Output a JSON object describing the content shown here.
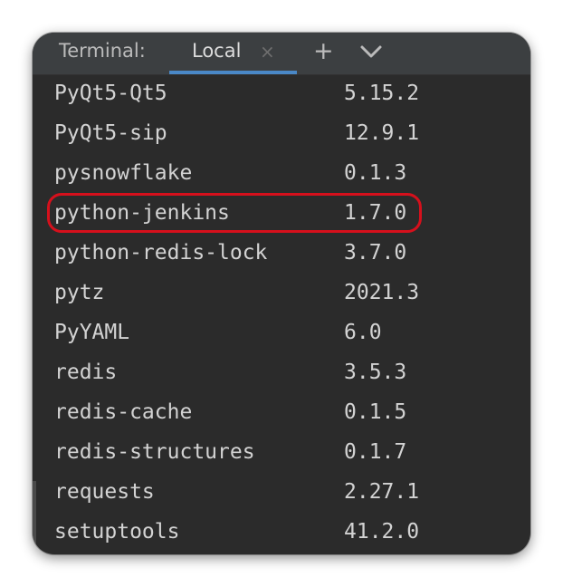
{
  "terminal": {
    "title": "Terminal:",
    "tabs": [
      {
        "label": "Local",
        "close_glyph": "×"
      }
    ],
    "add_glyph": "+",
    "menu_icon": "chevron-down-icon"
  },
  "packages": [
    {
      "name": "PyQt5-Qt5",
      "version": "5.15.2"
    },
    {
      "name": "PyQt5-sip",
      "version": "12.9.1"
    },
    {
      "name": "pysnowflake",
      "version": "0.1.3"
    },
    {
      "name": "python-jenkins",
      "version": "1.7.0"
    },
    {
      "name": "python-redis-lock",
      "version": "3.7.0"
    },
    {
      "name": "pytz",
      "version": "2021.3"
    },
    {
      "name": "PyYAML",
      "version": "6.0"
    },
    {
      "name": "redis",
      "version": "3.5.3"
    },
    {
      "name": "redis-cache",
      "version": "0.1.5"
    },
    {
      "name": "redis-structures",
      "version": "0.1.7"
    },
    {
      "name": "requests",
      "version": "2.27.1"
    },
    {
      "name": "setuptools",
      "version": "41.2.0"
    }
  ],
  "highlight": {
    "package": "python-jenkins",
    "color": "#d6101c"
  },
  "colors": {
    "terminal_bg": "#2b2b2b",
    "tabbar_bg": "#3c3f41",
    "text": "#d3d3d3",
    "active_tab_underline": "#4a88c7"
  }
}
